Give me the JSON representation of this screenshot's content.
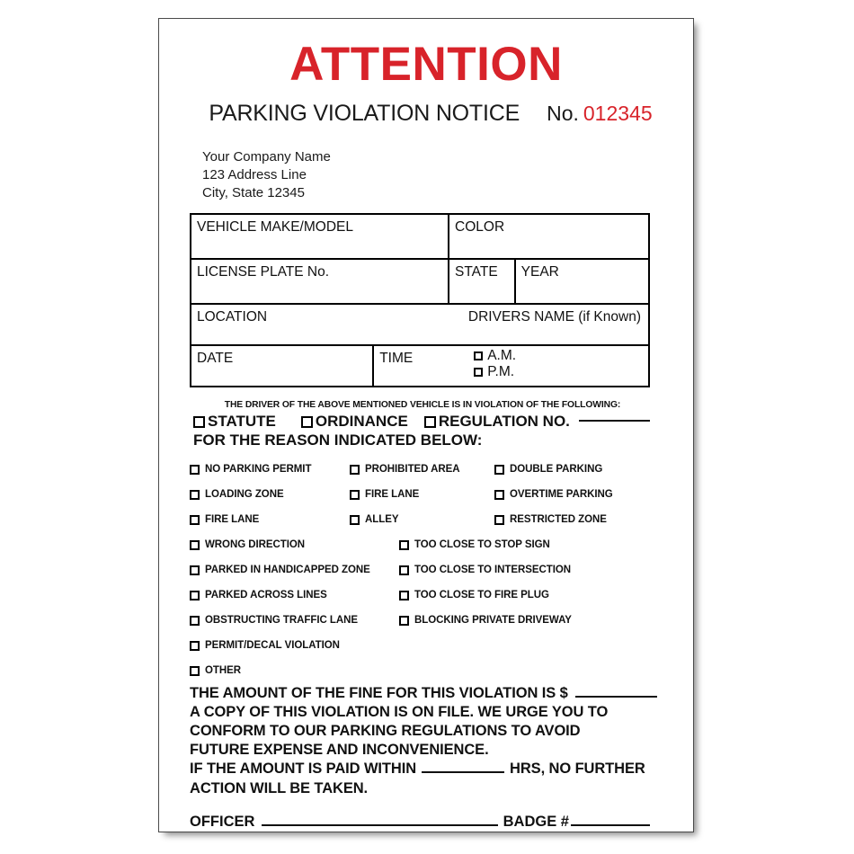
{
  "header": {
    "attention": "ATTENTION",
    "title": "PARKING VIOLATION NOTICE",
    "number_label": "No.",
    "number_value": "012345",
    "accent_color": "#d8232a"
  },
  "company": {
    "name": "Your Company Name",
    "address": "123 Address Line",
    "city_state_zip": "City, State 12345"
  },
  "form_table": {
    "vehicle_make_model": "VEHICLE MAKE/MODEL",
    "color": "COLOR",
    "license_plate": "LICENSE PLATE No.",
    "state": "STATE",
    "year": "YEAR",
    "location": "LOCATION",
    "drivers_name": "DRIVERS NAME (if Known)",
    "date": "DATE",
    "time": "TIME",
    "am": "A.M.",
    "pm": "P.M."
  },
  "violation_of": {
    "caption": "THE DRIVER OF THE ABOVE MENTIONED VEHICLE IS IN VIOLATION OF THE FOLLOWING:",
    "statute": "STATUTE",
    "ordinance": "ORDINANCE",
    "regulation_no": "REGULATION NO.",
    "reason_prompt": "FOR THE REASON INDICATED BELOW:"
  },
  "reasons": {
    "grid3": [
      [
        "NO PARKING PERMIT",
        "PROHIBITED AREA",
        "DOUBLE PARKING"
      ],
      [
        "LOADING ZONE",
        "FIRE LANE",
        "OVERTIME PARKING"
      ],
      [
        "FIRE LANE",
        "ALLEY",
        "RESTRICTED ZONE"
      ]
    ],
    "grid2": [
      [
        "WRONG DIRECTION",
        "TOO CLOSE TO STOP SIGN"
      ],
      [
        "PARKED IN HANDICAPPED ZONE",
        "TOO CLOSE TO INTERSECTION"
      ],
      [
        "PARKED ACROSS LINES",
        "TOO CLOSE TO FIRE PLUG"
      ],
      [
        "OBSTRUCTING TRAFFIC LANE",
        "BLOCKING PRIVATE DRIVEWAY"
      ]
    ],
    "solo": [
      "PERMIT/DECAL VIOLATION",
      "OTHER"
    ]
  },
  "statement": {
    "fine_prefix": "THE AMOUNT OF THE FINE FOR THIS VIOLATION IS $",
    "copy_line_1": "A COPY OF THIS VIOLATION IS ON FILE. WE URGE YOU TO",
    "copy_line_2": "CONFORM TO OUR PARKING REGULATIONS TO AVOID",
    "copy_line_3": "FUTURE EXPENSE AND INCONVENIENCE.",
    "paid_prefix": "IF THE AMOUNT IS PAID WITHIN",
    "paid_suffix": "HRS, NO FURTHER",
    "paid_line_2": "ACTION WILL BE TAKEN."
  },
  "footer": {
    "officer": "OFFICER",
    "badge": "BADGE #"
  }
}
